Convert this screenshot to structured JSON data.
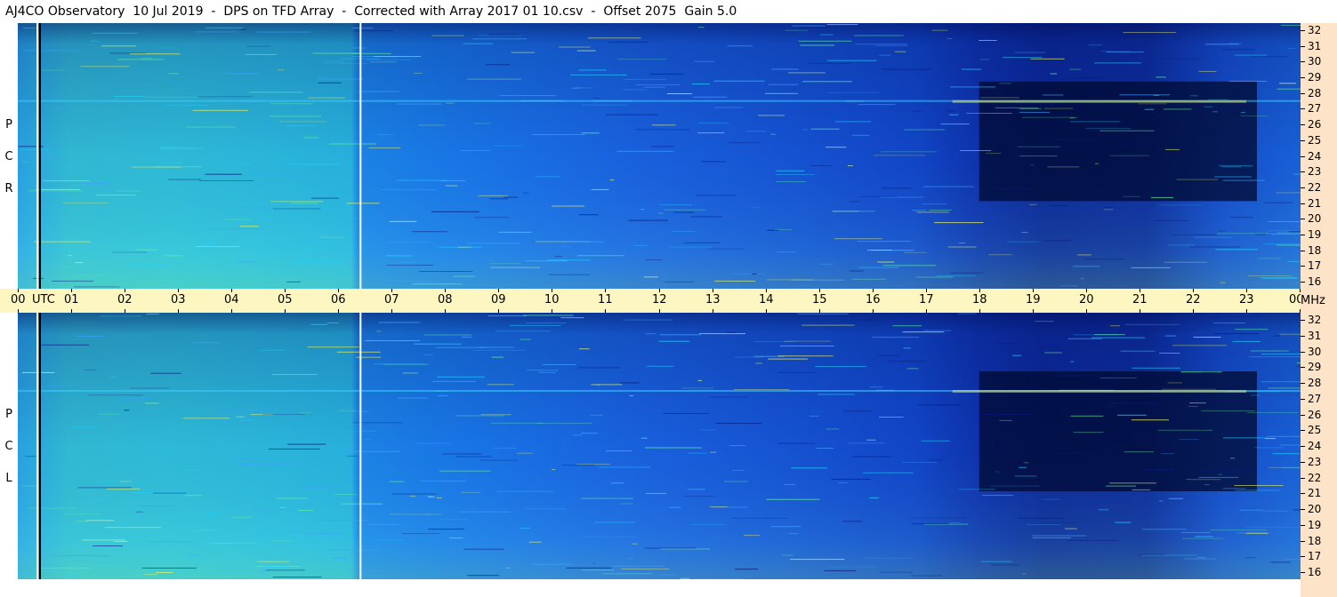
{
  "title": "AJ4CO Observatory  10 Jul 2019  -  DPS on TFD Array  -  Corrected with Array 2017 01 10.csv  -  Offset 2075  Gain 5.0",
  "panels": [
    {
      "id": "rcp",
      "letters": [
        "R",
        "C",
        "P"
      ]
    },
    {
      "id": "lcp",
      "letters": [
        "L",
        "C",
        "P"
      ]
    }
  ],
  "chart_data": {
    "type": "heatmap",
    "title": "AJ4CO Observatory  10 Jul 2019  -  DPS on TFD Array  -  Corrected with Array 2017 01 10.csv  -  Offset 2075  Gain 5.0",
    "x_axis": {
      "unit_label": "UTC",
      "tick_labels": [
        "00",
        "01",
        "02",
        "03",
        "04",
        "05",
        "06",
        "07",
        "08",
        "09",
        "10",
        "11",
        "12",
        "13",
        "14",
        "15",
        "16",
        "17",
        "18",
        "19",
        "20",
        "21",
        "22",
        "23",
        "00"
      ],
      "range": [
        0,
        24
      ]
    },
    "y_axis": {
      "unit_label": "MHz",
      "tick_labels": [
        "32",
        "31",
        "30",
        "29",
        "28",
        "27",
        "26",
        "25",
        "24",
        "23",
        "22",
        "21",
        "20",
        "19",
        "18",
        "17",
        "16"
      ],
      "range": [
        16,
        32
      ]
    },
    "series": [
      {
        "name": "RCP",
        "channel_letters": [
          "R",
          "C",
          "P"
        ]
      },
      {
        "name": "LCP",
        "channel_letters": [
          "L",
          "C",
          "P"
        ]
      }
    ],
    "vertical_markers_utc": [
      0.4,
      6.4
    ],
    "colormap": [
      "#000a3a",
      "#06208f",
      "#1040d8",
      "#1a78f0",
      "#22b4e6",
      "#5ae0a8",
      "#e8f060",
      "#ff6030"
    ]
  }
}
